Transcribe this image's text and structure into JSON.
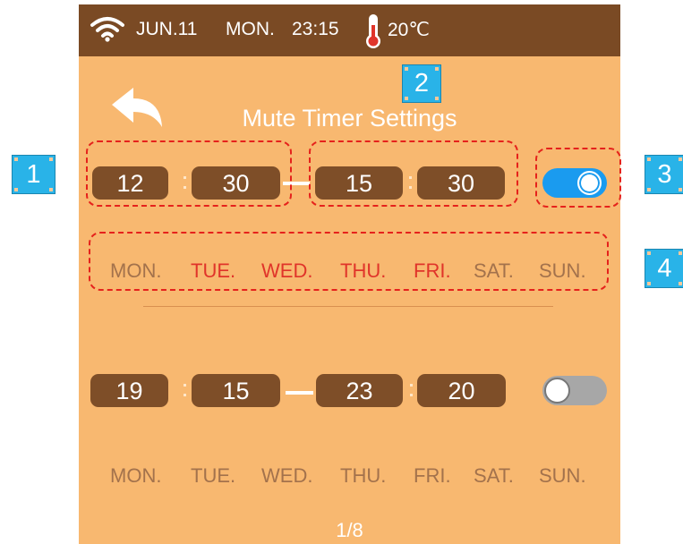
{
  "status_bar": {
    "wifi_icon": "wifi-icon",
    "date": "JUN.11",
    "day": "MON.",
    "time": "23:15",
    "thermometer_icon": "thermometer-icon",
    "temperature": "20℃"
  },
  "header": {
    "back_icon": "back-arrow-icon",
    "title": "Mute Timer Settings"
  },
  "timers": [
    {
      "start_hour": "12",
      "start_minute": "30",
      "end_hour": "15",
      "end_minute": "30",
      "enabled": true,
      "days": [
        {
          "label": "MON.",
          "active": false
        },
        {
          "label": "TUE.",
          "active": true
        },
        {
          "label": "WED.",
          "active": true
        },
        {
          "label": "THU.",
          "active": true
        },
        {
          "label": "FRI.",
          "active": true
        },
        {
          "label": "SAT.",
          "active": false
        },
        {
          "label": "SUN.",
          "active": false
        }
      ]
    },
    {
      "start_hour": "19",
      "start_minute": "15",
      "end_hour": "23",
      "end_minute": "20",
      "enabled": false,
      "days": [
        {
          "label": "MON.",
          "active": false
        },
        {
          "label": "TUE.",
          "active": false
        },
        {
          "label": "WED.",
          "active": false
        },
        {
          "label": "THU.",
          "active": false
        },
        {
          "label": "FRI.",
          "active": false
        },
        {
          "label": "SAT.",
          "active": false
        },
        {
          "label": "SUN.",
          "active": false
        }
      ]
    }
  ],
  "page_indicator": "1/8",
  "annotations": [
    "1",
    "2",
    "3",
    "4"
  ],
  "colors": {
    "status_bar": "#7a4a24",
    "background": "#f8b870",
    "pill": "#7e4e28",
    "toggle_on": "#1a9bef",
    "toggle_off": "#a7a7a7",
    "day_active": "#e0342a",
    "day_inactive": "#a3724c",
    "annotation_box": "#e5221c",
    "annotation_marker": "#29b3e8"
  }
}
